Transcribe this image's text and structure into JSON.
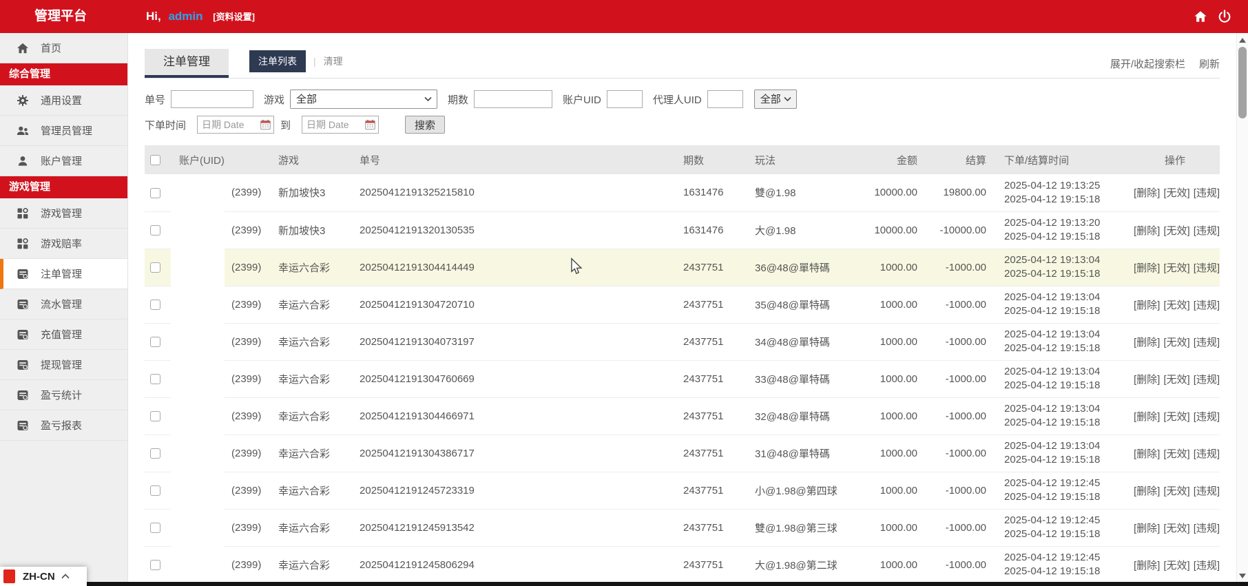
{
  "header": {
    "brand": "管理平台",
    "greeting_prefix": "Hi,",
    "username": "admin",
    "profile_link": "[资料设置]",
    "icons": [
      "home-icon",
      "power-icon"
    ]
  },
  "sidebar": {
    "items": [
      {
        "name": "home",
        "label": "首页",
        "type": "item",
        "icon": "home-icon"
      },
      {
        "name": "section-general",
        "label": "综合管理",
        "type": "section"
      },
      {
        "name": "general-settings",
        "label": "通用设置",
        "type": "item",
        "icon": "gear-icon"
      },
      {
        "name": "admin-management",
        "label": "管理员管理",
        "type": "item",
        "icon": "users-icon"
      },
      {
        "name": "account-management",
        "label": "账户管理",
        "type": "item",
        "icon": "user-icon"
      },
      {
        "name": "section-game",
        "label": "游戏管理",
        "type": "section"
      },
      {
        "name": "game-management",
        "label": "游戏管理",
        "type": "item",
        "icon": "grid-icon"
      },
      {
        "name": "game-odds",
        "label": "游戏赔率",
        "type": "item",
        "icon": "grid-icon"
      },
      {
        "name": "bet-management",
        "label": "注单管理",
        "type": "item",
        "icon": "report-icon",
        "active": true
      },
      {
        "name": "flow-management",
        "label": "流水管理",
        "type": "item",
        "icon": "report-icon"
      },
      {
        "name": "recharge-management",
        "label": "充值管理",
        "type": "item",
        "icon": "report-icon"
      },
      {
        "name": "withdraw-management",
        "label": "提现管理",
        "type": "item",
        "icon": "report-icon"
      },
      {
        "name": "profit-stats",
        "label": "盈亏统计",
        "type": "item",
        "icon": "report-icon"
      },
      {
        "name": "profit-report",
        "label": "盈亏报表",
        "type": "item",
        "icon": "report-icon"
      }
    ],
    "language": "ZH-CN"
  },
  "page": {
    "module_tab": "注单管理",
    "tabs": [
      {
        "label": "注单列表",
        "active": true
      },
      {
        "label": "清理",
        "active": false
      }
    ],
    "tab_divider": "|",
    "toolbar": {
      "toggle_search": "展开/收起搜索栏",
      "refresh": "刷新"
    }
  },
  "search": {
    "order_label": "单号",
    "game_label": "游戏",
    "game_value": "全部",
    "period_label": "期数",
    "account_uid_label": "账户UID",
    "agent_uid_label": "代理人UID",
    "status_value": "全部",
    "time_label": "下单时间",
    "date_placeholder": "日期 Date",
    "to_label": "到",
    "search_button": "搜索"
  },
  "table": {
    "columns": [
      "账户(UID)",
      "游戏",
      "单号",
      "期数",
      "玩法",
      "金额",
      "结算",
      "下单/结算时间",
      "操作"
    ],
    "action_labels": [
      "[删除]",
      "[无效]",
      "[违规]"
    ],
    "action_names": [
      "delete",
      "invalid",
      "violation"
    ],
    "rows": [
      {
        "account": "(2399)",
        "game": "新加坡快3",
        "order": "20250412191325215810",
        "period": "1631476",
        "play": "雙@1.98",
        "amount": "10000.00",
        "settle": "19800.00",
        "time_placed": "2025-04-12 19:13:25",
        "time_settled": "2025-04-12 19:15:18",
        "highlight": false
      },
      {
        "account": "(2399)",
        "game": "新加坡快3",
        "order": "20250412191320130535",
        "period": "1631476",
        "play": "大@1.98",
        "amount": "10000.00",
        "settle": "-10000.00",
        "time_placed": "2025-04-12 19:13:20",
        "time_settled": "2025-04-12 19:15:18",
        "highlight": false
      },
      {
        "account": "(2399)",
        "game": "幸运六合彩",
        "order": "20250412191304414449",
        "period": "2437751",
        "play": "36@48@單特碼",
        "amount": "1000.00",
        "settle": "-1000.00",
        "time_placed": "2025-04-12 19:13:04",
        "time_settled": "2025-04-12 19:15:18",
        "highlight": true
      },
      {
        "account": "(2399)",
        "game": "幸运六合彩",
        "order": "20250412191304720710",
        "period": "2437751",
        "play": "35@48@單特碼",
        "amount": "1000.00",
        "settle": "-1000.00",
        "time_placed": "2025-04-12 19:13:04",
        "time_settled": "2025-04-12 19:15:18",
        "highlight": false
      },
      {
        "account": "(2399)",
        "game": "幸运六合彩",
        "order": "20250412191304073197",
        "period": "2437751",
        "play": "34@48@單特碼",
        "amount": "1000.00",
        "settle": "-1000.00",
        "time_placed": "2025-04-12 19:13:04",
        "time_settled": "2025-04-12 19:15:18",
        "highlight": false
      },
      {
        "account": "(2399)",
        "game": "幸运六合彩",
        "order": "20250412191304760669",
        "period": "2437751",
        "play": "33@48@單特碼",
        "amount": "1000.00",
        "settle": "-1000.00",
        "time_placed": "2025-04-12 19:13:04",
        "time_settled": "2025-04-12 19:15:18",
        "highlight": false
      },
      {
        "account": "(2399)",
        "game": "幸运六合彩",
        "order": "20250412191304466971",
        "period": "2437751",
        "play": "32@48@單特碼",
        "amount": "1000.00",
        "settle": "-1000.00",
        "time_placed": "2025-04-12 19:13:04",
        "time_settled": "2025-04-12 19:15:18",
        "highlight": false
      },
      {
        "account": "(2399)",
        "game": "幸运六合彩",
        "order": "20250412191304386717",
        "period": "2437751",
        "play": "31@48@單特碼",
        "amount": "1000.00",
        "settle": "-1000.00",
        "time_placed": "2025-04-12 19:13:04",
        "time_settled": "2025-04-12 19:15:18",
        "highlight": false
      },
      {
        "account": "(2399)",
        "game": "幸运六合彩",
        "order": "20250412191245723319",
        "period": "2437751",
        "play": "小@1.98@第四球",
        "amount": "1000.00",
        "settle": "-1000.00",
        "time_placed": "2025-04-12 19:12:45",
        "time_settled": "2025-04-12 19:15:18",
        "highlight": false
      },
      {
        "account": "(2399)",
        "game": "幸运六合彩",
        "order": "20250412191245913542",
        "period": "2437751",
        "play": "雙@1.98@第三球",
        "amount": "1000.00",
        "settle": "-1000.00",
        "time_placed": "2025-04-12 19:12:45",
        "time_settled": "2025-04-12 19:15:18",
        "highlight": false
      },
      {
        "account": "(2399)",
        "game": "幸运六合彩",
        "order": "20250412191245806294",
        "period": "2437751",
        "play": "大@1.98@第二球",
        "amount": "1000.00",
        "settle": "-1000.00",
        "time_placed": "2025-04-12 19:12:45",
        "time_settled": "2025-04-12 19:15:18",
        "highlight": false
      }
    ]
  },
  "colors": {
    "accent_red": "#D1121D",
    "navy": "#2E3A52",
    "active_orange": "#F0760F",
    "username_blue": "#2BA3F0",
    "row_highlight": "#F8F8E2"
  }
}
